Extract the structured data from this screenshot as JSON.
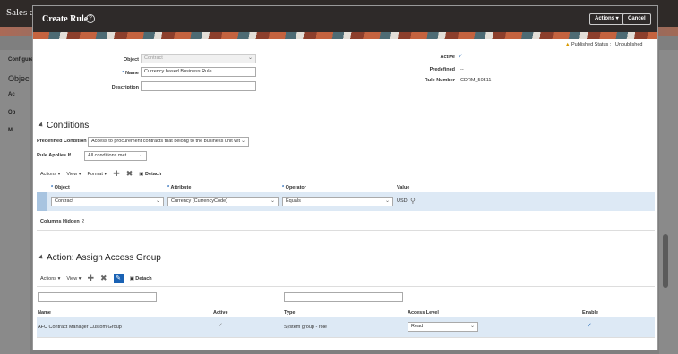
{
  "background": {
    "app_title": "Sales a",
    "left_items": [
      "Configure",
      "Objec",
      "Ac",
      "Ob",
      "M"
    ]
  },
  "dialog": {
    "title": "Create Rule",
    "actions_label": "Actions ▾",
    "cancel_label": "Cancel",
    "published_status_label": "Published Status :",
    "published_status_value": "Unpublished"
  },
  "form": {
    "object_label": "Object",
    "object_value": "Contract",
    "name_label": "Name",
    "name_value": "Currency based Business Rule",
    "description_label": "Description",
    "description_value": "",
    "active_label": "Active",
    "predefined_label": "Predefined",
    "predefined_value": "--",
    "rule_number_label": "Rule Number",
    "rule_number_value": "CDRM_50511"
  },
  "conditions": {
    "title": "Conditions",
    "predefined_condition_label": "Predefined Condition",
    "predefined_condition_value": "Access to procurement contracts that belong to the business unit wit!",
    "rule_applies_label": "Rule Applies If",
    "rule_applies_value": "All conditions met.",
    "toolbar": {
      "actions": "Actions",
      "view": "View",
      "format": "Format",
      "detach": "Detach"
    },
    "columns": [
      "Object",
      "Attribute",
      "Operator",
      "Value"
    ],
    "row": {
      "object": "Contract",
      "attribute": "Currency (CurrencyCode)",
      "operator": "Equals",
      "value": "USD"
    },
    "columns_hidden_label": "Columns Hidden",
    "columns_hidden_value": "2"
  },
  "action": {
    "title": "Action: Assign Access Group",
    "toolbar": {
      "actions": "Actions",
      "view": "View",
      "detach": "Detach"
    },
    "columns": [
      "Name",
      "Active",
      "Type",
      "Access Level",
      "Enable"
    ],
    "row": {
      "name": "AFU Contract Manager Custom Group",
      "type": "System group - role",
      "access_level": "Read"
    }
  }
}
